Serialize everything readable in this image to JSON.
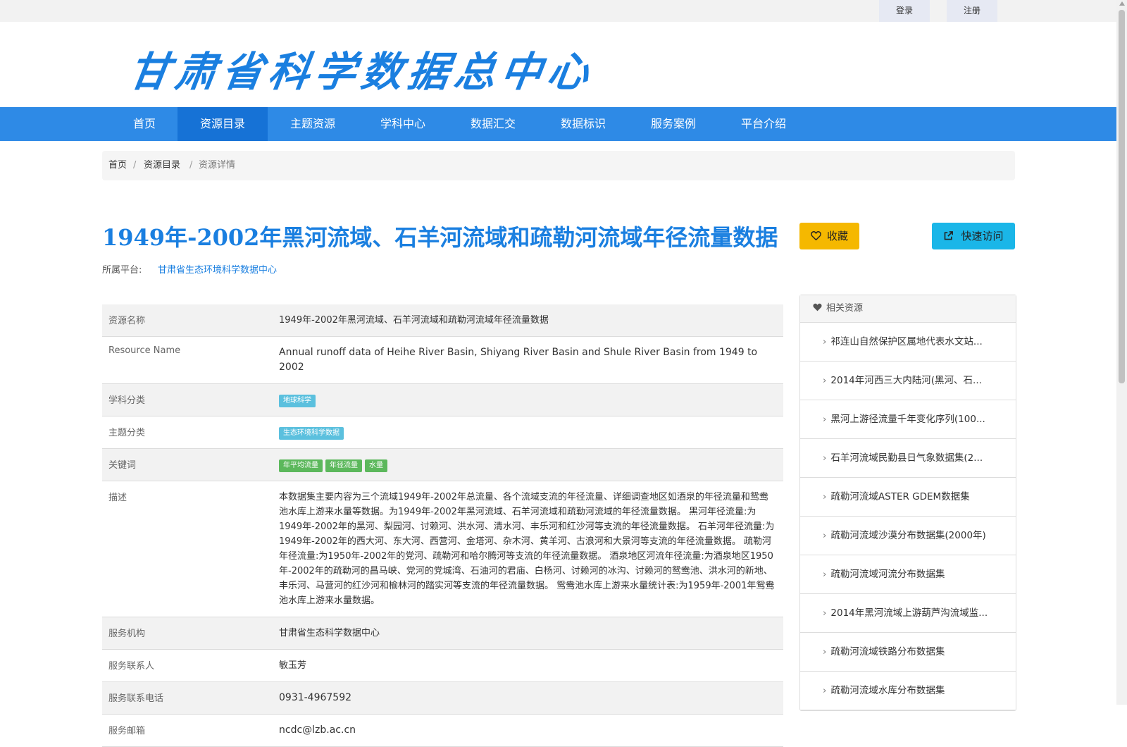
{
  "topbar": {
    "login": "登录",
    "register": "注册"
  },
  "header": {
    "logo_text": "甘肃省科学数据总中心"
  },
  "nav": {
    "items": [
      {
        "label": "首页"
      },
      {
        "label": "资源目录"
      },
      {
        "label": "主题资源"
      },
      {
        "label": "学科中心"
      },
      {
        "label": "数据汇交"
      },
      {
        "label": "数据标识"
      },
      {
        "label": "服务案例"
      },
      {
        "label": "平台介绍"
      }
    ],
    "active": "资源目录"
  },
  "breadcrumb": {
    "home": "首页",
    "sep": "/",
    "catalog": "资源目录",
    "current": "资源详情"
  },
  "resource": {
    "title": "1949年-2002年黑河流域、石羊河流域和疏勒河流域年径流量数据",
    "favorite_label": "收藏",
    "quick_access_label": "快速访问",
    "platform_label": "所属平台:",
    "platform_name": "甘肃省生态环境科学数据中心"
  },
  "details": {
    "name_k": "资源名称",
    "name_v": "1949年-2002年黑河流域、石羊河流域和疏勒河流域年径流量数据",
    "en_k": "Resource Name",
    "en_v": "Annual runoff data of Heihe River Basin, Shiyang River Basin and Shule River Basin from 1949 to 2002",
    "subject_k": "学科分类",
    "subject_tag": "地球科学",
    "theme_k": "主题分类",
    "theme_tag": "生态环境科学数据",
    "keywords_k": "关键词",
    "keywords": [
      "年平均流量",
      "年径流量",
      "水量"
    ],
    "desc_k": "描述",
    "desc_v": "本数据集主要内容为三个流域1949年-2002年总流量、各个流域支流的年径流量、详细调查地区如酒泉的年径流量和鸳鸯池水库上游来水量等数据。为1949年-2002年黑河流域、石羊河流域和疏勒河流域的年径流量数据。 黑河年径流量:为1949年-2002年的黑河、梨园河、讨赖河、洪水河、清水河、丰乐河和红沙河等支流的年径流量数据。 石羊河年径流量:为1949年-2002年的西大河、东大河、西营河、金塔河、杂木河、黄羊河、古浪河和大景河等支流的年径流量数据。 疏勒河年径流量:为1950年-2002年的党河、疏勒河和哈尔腾河等支流的年径流量数据。 酒泉地区河流年径流量:为酒泉地区1950年-2002年的疏勒河的昌马峡、党河的党城湾、石油河的君庙、白杨河、讨赖河的冰沟、讨赖河的鸳鸯池、洪水河的新地、丰乐河、马营河的红沙河和榆林河的踏实河等支流的年径流量数据。 鸳鸯池水库上游来水量统计表:为1959年-2001年鸳鸯池水库上游来水量数据。",
    "org_k": "服务机构",
    "org_v": "甘肃省生态科学数据中心",
    "contact_k": "服务联系人",
    "contact_v": "敏玉芳",
    "phone_k": "服务联系电话",
    "phone_v": "0931-4967592",
    "email_k": "服务邮箱",
    "email_v": "ncdc@lzb.ac.cn"
  },
  "related": {
    "title": "相关资源",
    "items": [
      "祁连山自然保护区属地代表水文站...",
      "2014年河西三大内陆河(黑河、石...",
      "黑河上游径流量千年变化序列(100...",
      "石羊河流域民勤县日气象数据集(2...",
      "疏勒河流域ASTER GDEM数据集",
      "疏勒河流域沙漠分布数据集(2000年)",
      "疏勒河流域河流分布数据集",
      "2014年黑河流域上游葫芦沟流域监...",
      "疏勒河流域铁路分布数据集",
      "疏勒河流域水库分布数据集"
    ]
  }
}
